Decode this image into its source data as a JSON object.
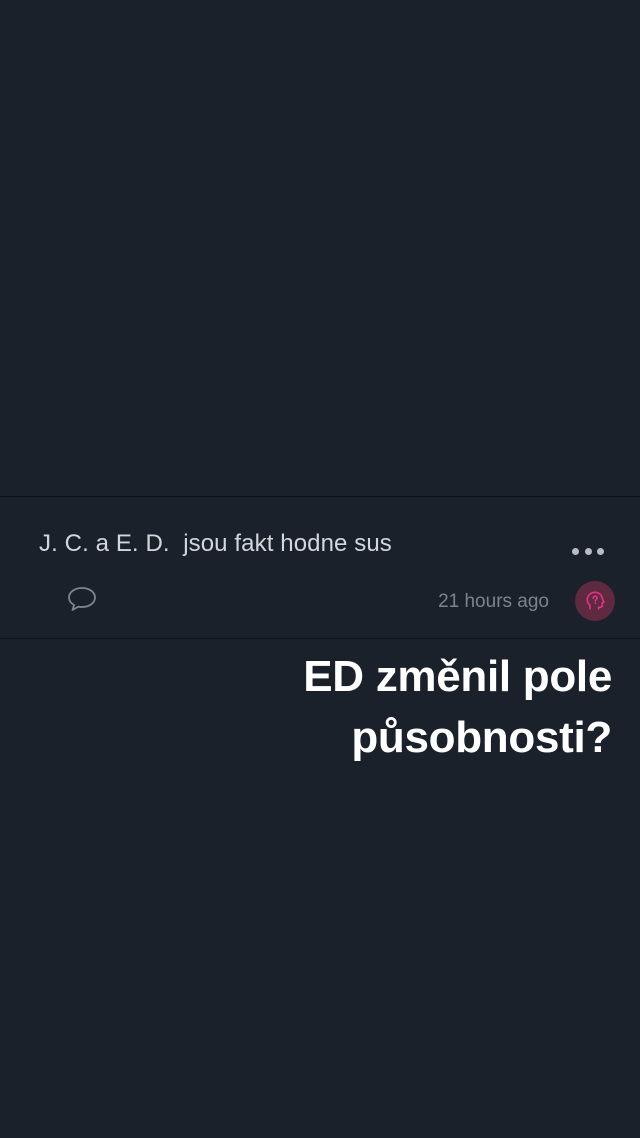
{
  "post": {
    "text": "J. C. a E. D.  jsou fakt hodne sus",
    "timestamp": "21 hours ago",
    "icons": {
      "more": "more-horizontal-icon",
      "comment": "comment-bubble-icon",
      "reaction": "head-question-icon"
    }
  },
  "overlay": {
    "line1": "ED změnil pole",
    "line2": "působnosti?"
  },
  "colors": {
    "background": "#1b212b",
    "reaction_accent": "#e8308a",
    "reaction_bg": "#5d2a40"
  }
}
